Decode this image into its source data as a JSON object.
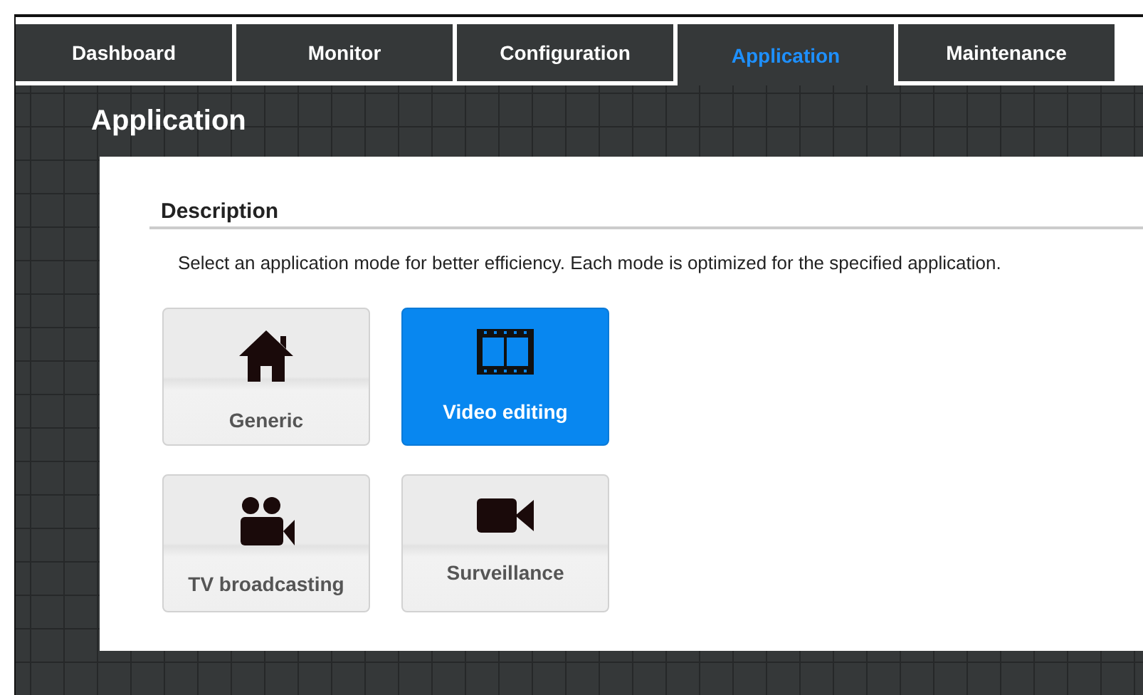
{
  "tabs": [
    {
      "label": "Dashboard",
      "selected": false
    },
    {
      "label": "Monitor",
      "selected": false
    },
    {
      "label": "Configuration",
      "selected": false
    },
    {
      "label": "Application",
      "selected": true
    },
    {
      "label": "Maintenance",
      "selected": false
    }
  ],
  "page_title": "Application",
  "section": {
    "title": "Description",
    "text": "Select an application mode for better efficiency. Each mode is optimized for the specified application."
  },
  "modes": [
    {
      "label": "Generic",
      "kind": "house",
      "selected": false
    },
    {
      "label": "Video editing",
      "kind": "film",
      "selected": true
    },
    {
      "label": "TV broadcasting",
      "kind": "movie-camera",
      "selected": false
    },
    {
      "label": "Surveillance",
      "kind": "video-camera",
      "selected": false
    }
  ]
}
